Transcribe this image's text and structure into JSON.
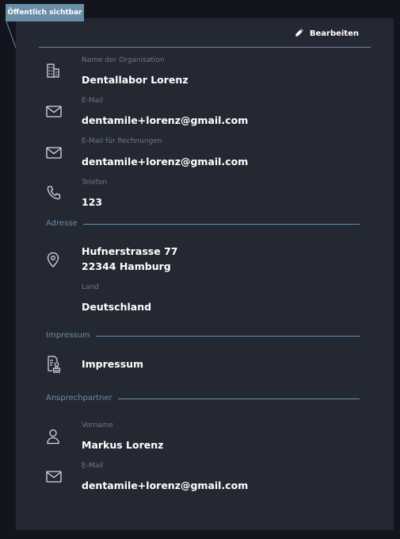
{
  "badge": {
    "label": "Öffentlich sichtbar"
  },
  "toolbar": {
    "edit_label": "Bearbeiten"
  },
  "organization": {
    "name_label": "Name der Organisation",
    "name_value": "Dentallabor Lorenz",
    "email_label": "E-Mail",
    "email_value": "dentamile+lorenz@gmail.com",
    "billing_email_label": "E-Mail für Rechnungen",
    "billing_email_value": "dentamile+lorenz@gmail.com",
    "phone_label": "Telefon",
    "phone_value": "123"
  },
  "address": {
    "section_title": "Adresse",
    "street": "Hufnerstrasse 77",
    "city": "22344 Hamburg",
    "country_label": "Land",
    "country_value": "Deutschland"
  },
  "imprint": {
    "section_title": "Impressum",
    "link_label": "Impressum"
  },
  "contact": {
    "section_title": "Ansprechpartner",
    "firstname_label": "Vorname",
    "firstname_value": "Markus Lorenz",
    "email_label": "E-Mail",
    "email_value": "dentamile+lorenz@gmail.com"
  },
  "icons": {
    "organization": "building-icon",
    "email": "mail-icon",
    "phone": "phone-icon",
    "address": "map-pin-icon",
    "imprint": "document-stamp-icon",
    "contact": "user-icon",
    "edit": "pencil-icon"
  },
  "colors": {
    "background": "#12151d",
    "card": "#242833",
    "accent": "#6b8ea7",
    "label": "#6e7684",
    "text": "#ffffff"
  }
}
